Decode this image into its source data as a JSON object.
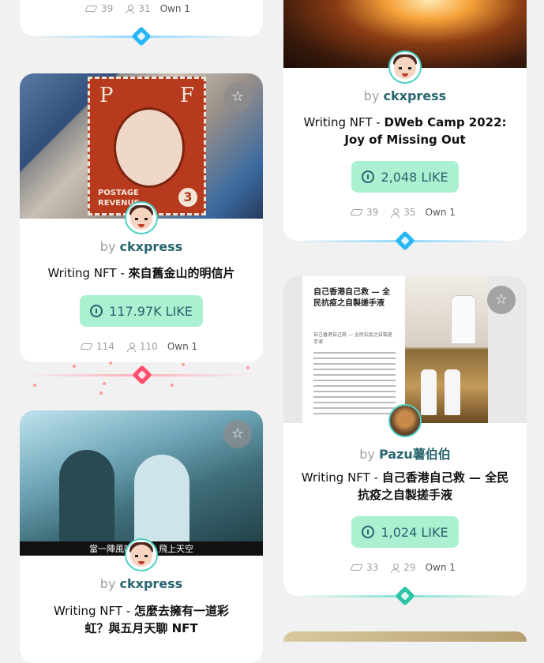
{
  "cards": [
    {
      "stats": {
        "editions": "39",
        "owners": "31",
        "own": "Own 1"
      }
    },
    {
      "by": "by",
      "author": "ckxpress",
      "title_prefix": "Writing NFT - ",
      "title": "來自舊金山的明信片",
      "like": "117.97K LIKE",
      "stats": {
        "editions": "114",
        "owners": "110",
        "own": "Own 1"
      },
      "image_text": {
        "p": "P",
        "f": "F",
        "postage": "POSTAGE",
        "revenue": "REVENUE",
        "num": "3"
      }
    },
    {
      "by": "by",
      "author": "ckxpress",
      "title_prefix": "Writing NFT - ",
      "title": "怎麼去擁有一道彩虹？與五月天聊 NFT",
      "image_caption": "當一陣風吹　　　飛上天空"
    },
    {
      "by": "by",
      "author": "ckxpress",
      "title_prefix": "Writing NFT - ",
      "title": "DWeb Camp 2022: Joy of Missing Out",
      "like": "2,048 LIKE",
      "stats": {
        "editions": "39",
        "owners": "35",
        "own": "Own 1"
      }
    },
    {
      "by": "by",
      "author": "Pazu薯伯伯",
      "title_prefix": "Writing NFT - ",
      "title": "自己香港自己救 — 全民抗疫之自製搓手液",
      "like": "1,024 LIKE",
      "stats": {
        "editions": "33",
        "owners": "29",
        "own": "Own 1"
      },
      "image_text": {
        "headline": "自己香港自己救 — 全民抗疫之自製搓手液",
        "sub": "自己香港自己救 — 全民抗疫之自製搓手液"
      }
    }
  ],
  "icons": {
    "star": "star-icon",
    "like": "like-info-icon",
    "layers": "layers-icon",
    "user": "user-icon"
  },
  "colors": {
    "accent_teal": "#28646e",
    "like_bg": "#aaf0d1",
    "gem_blue": "#29b6f6",
    "gem_red": "#ff4f6d",
    "gem_green": "#2ec4a6"
  }
}
